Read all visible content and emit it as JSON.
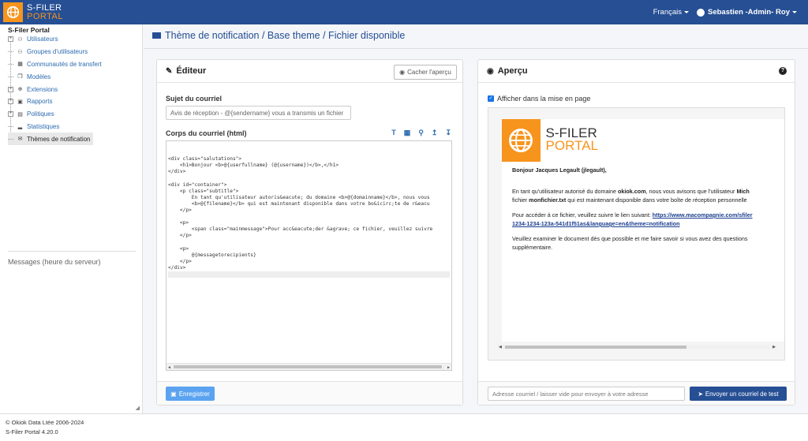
{
  "app": {
    "logo_line1": "S-FILER",
    "logo_line2": "PORTAL"
  },
  "topbar": {
    "language": "Français",
    "user": "Sebastien -Admin- Roy"
  },
  "sidebar": {
    "title": "S-Filer Portal",
    "items": [
      {
        "label": "Utilisateurs",
        "expandable": true,
        "icon": "user-icon"
      },
      {
        "label": "Groupes d'utilisateurs",
        "expandable": false,
        "icon": "users-icon"
      },
      {
        "label": "Communautés de transfert",
        "expandable": false,
        "icon": "sitemap-icon"
      },
      {
        "label": "Modèles",
        "expandable": false,
        "icon": "copy-icon"
      },
      {
        "label": "Extensions",
        "expandable": true,
        "icon": "plus-circle-icon"
      },
      {
        "label": "Rapports",
        "expandable": true,
        "icon": "file-icon"
      },
      {
        "label": "Politiques",
        "expandable": true,
        "icon": "file-text-icon"
      },
      {
        "label": "Statistiques",
        "expandable": false,
        "icon": "chart-icon"
      },
      {
        "label": "Thèmes de notification",
        "expandable": false,
        "icon": "envelope-icon",
        "active": true
      }
    ],
    "messages_title": "Messages (heure du serveur)"
  },
  "page": {
    "title": "Thème de notification / Base theme / Fichier disponible"
  },
  "editor": {
    "title": "Éditeur",
    "hide_preview": "Cacher l'aperçu",
    "subject_label": "Sujet du courriel",
    "subject_value": "Avis de réception - @{sendername} vous a transmis un fichier",
    "body_label": "Corps du courriel (html)",
    "save_button": "Enregistrer",
    "code_lines": [
      "<div class=\"salutations\">",
      "    <h1>Bonjour <b>@{userfullname} (@{username})</b>,</h1>",
      "</div>",
      "",
      "<div id=\"container\">",
      "    <p class=\"subtitle\">",
      "        En tant qu'utilisateur autoris&eacute; du domaine <b>@{domainname}</b>, nous vous",
      "        <b>@{filename}</b> qui est maintenant disponible dans votre bo&icirc;te de r&eacu",
      "    </p>",
      "",
      "    <p>",
      "        <span class=\"mainmessage\">Pour acc&eacute;der &agrave; ce fichier, veuillez suivre",
      "    </p>",
      "",
      "    <p>",
      "        @{messagetorecipients}",
      "    </p>",
      "</div>",
      ""
    ]
  },
  "preview": {
    "title": "Aperçu",
    "show_layout": "Afficher dans la mise en page",
    "greeting": "Bonjour Jacques Legault (jlegault),",
    "p1_line1_a": "En tant qu'utilisateur autorisé du domaine ",
    "p1_domain": "okiok.com",
    "p1_line1_b": ", nous vous avisons que l'utilisateur ",
    "p1_user": "Mich",
    "p1_line2_a": "fichier ",
    "p1_file": "monfichier.txt",
    "p1_line2_b": " qui est maintenant disponible dans votre boîte de réception personnelle",
    "p2_line1": "Pour accéder à ce fichier, veuillez suivre le lien suivant: ",
    "p2_link1": "https://www.macompagnie.com/sfiler",
    "p2_link2": "1234-1234-123a-541d1f51as&language=en&theme=notification",
    "p3_line1": "Veuillez examiner le document dès que possible et me faire savoir si vous avez des questions",
    "p3_line2": "supplémentaire.",
    "email_placeholder": "Adresse courriel / laisser vide pour envoyer à votre adresse",
    "send_button": "Envoyer un courriel de test"
  },
  "footer": {
    "copyright": "© Okiok Data Ltée 2006-2024",
    "version": "S-Filer Portal 4.20.0"
  }
}
